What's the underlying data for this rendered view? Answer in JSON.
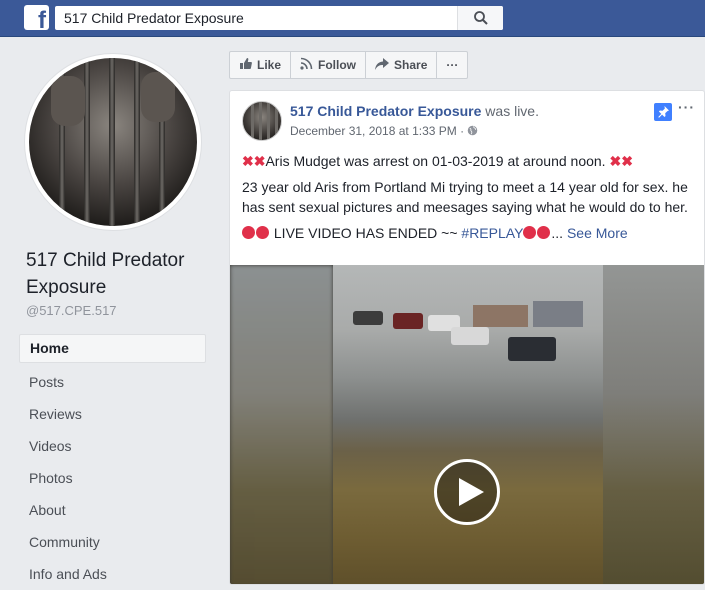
{
  "topbar": {
    "logo": "f",
    "search_value": "517 Child Predator Exposure"
  },
  "sidebar": {
    "page_name": "517 Child Predator Exposure",
    "handle": "@517.CPE.517",
    "nav": [
      "Home",
      "Posts",
      "Reviews",
      "Videos",
      "Photos",
      "About",
      "Community",
      "Info and Ads"
    ],
    "active_index": 0
  },
  "actions": {
    "like": "Like",
    "follow": "Follow",
    "share": "Share",
    "more": "···"
  },
  "post": {
    "author": "517 Child Predator Exposure",
    "status": "was live.",
    "date": "December 31, 2018 at 1:33 PM · ",
    "more": "···",
    "line1": "Aris Mudget was arrest on 01-03-2019 at around noon.",
    "line2": "23 year old Aris from Portland Mi trying to meet a 14 year old for sex. he has sent sexual pictures and meesages saying what he would do to her.",
    "line3_text": " LIVE VIDEO HAS ENDED ~~ ",
    "hashtag": "#REPLAY",
    "ellipsis": "...",
    "see_more": "See More"
  },
  "colors": {
    "topbar": "#3b5998",
    "link": "#385898",
    "pin": "#4080ff",
    "emoji_red": "#e0304a"
  }
}
